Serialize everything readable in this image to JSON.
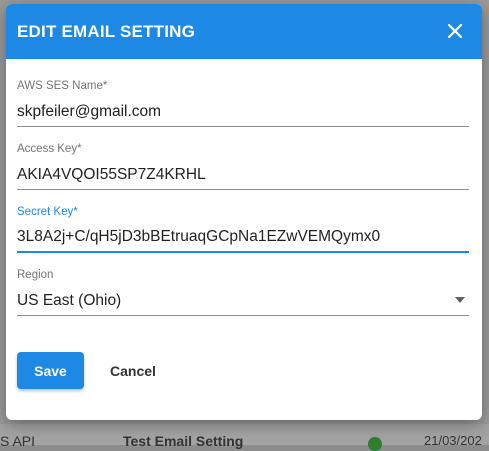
{
  "background": {
    "left_text": "S API",
    "middle_text": "Test Email Setting",
    "right_text": "21/03/202"
  },
  "dialog": {
    "title": "EDIT EMAIL SETTING",
    "close_icon": "close-icon"
  },
  "form": {
    "ses_name": {
      "label": "AWS SES Name*",
      "value": "skpfeiler@gmail.com"
    },
    "access_key": {
      "label": "Access Key*",
      "value": "AKIA4VQOI55SP7Z4KRHL"
    },
    "secret_key": {
      "label": "Secret Key*",
      "value": "3L8A2j+C/qH5jD3bBEtruaqGCpNa1EZwVEMQymx0"
    },
    "region": {
      "label": "Region",
      "value": "US East (Ohio)"
    }
  },
  "actions": {
    "save_label": "Save",
    "cancel_label": "Cancel"
  },
  "colors": {
    "primary": "#1e88e5",
    "header_text": "#ffffff"
  }
}
